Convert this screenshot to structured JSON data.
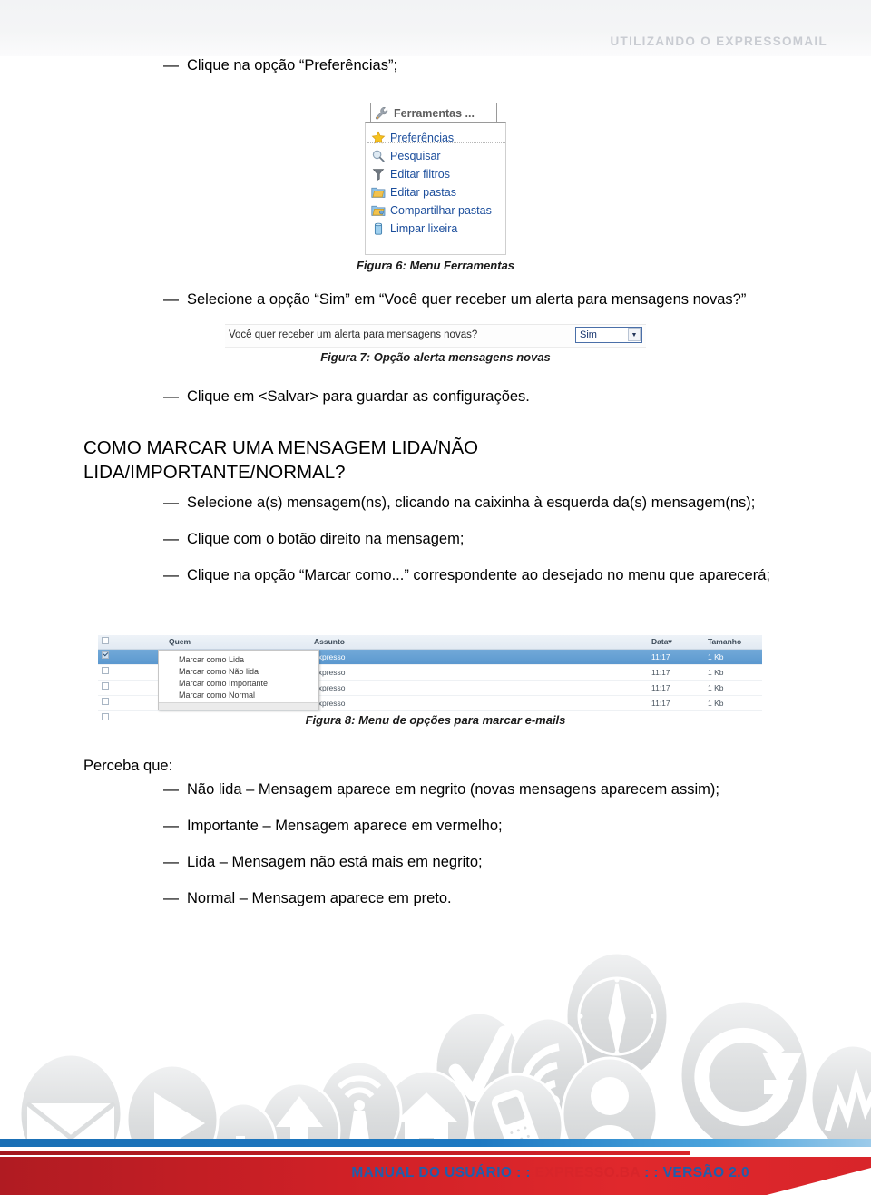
{
  "header": {
    "title": "UTILIZANDO O EXPRESSOMAIL"
  },
  "body": {
    "step_preferencias": "Clique na opção “Preferências”;",
    "step_sim": "Selecione a opção “Sim” em “Você quer receber um alerta para mensagens novas?”",
    "step_salvar": "Clique em <Salvar> para guardar as configurações.",
    "heading_marcar": "COMO MARCAR UMA MENSAGEM LIDA/NÃO LIDA/IMPORTANTE/NORMAL?",
    "step_selecione": "Selecione a(s) mensagem(ns), clicando na caixinha à esquerda da(s) mensagem(ns);",
    "step_botao_direito": "Clique com o botão direito na mensagem;",
    "step_marcar_como": "Clique na opção “Marcar como...” correspondente ao desejado no menu que aparecerá;",
    "perceba_que": "Perceba que:",
    "note_nao_lida": "Não lida – Mensagem aparece em negrito (novas mensagens aparecem assim);",
    "note_importante": "Importante – Mensagem aparece em vermelho;",
    "note_lida": "Lida – Mensagem não está mais em negrito;",
    "note_normal": "Normal – Mensagem aparece em preto.",
    "dash": "—"
  },
  "figure6": {
    "caption": "Figura 6: Menu Ferramentas",
    "tab_label": "Ferramentas ...",
    "tab_icon": "wrench-icon",
    "items": [
      {
        "label": "Preferências",
        "icon": "star-icon"
      },
      {
        "label": "Pesquisar",
        "icon": "magnifier-icon"
      },
      {
        "label": "Editar filtros",
        "icon": "funnel-icon"
      },
      {
        "label": "Editar pastas",
        "icon": "folder-icon"
      },
      {
        "label": "Compartilhar pastas",
        "icon": "shared-folder-icon"
      },
      {
        "label": "Limpar lixeira",
        "icon": "trash-icon"
      }
    ]
  },
  "figure7": {
    "caption": "Figura 7: Opção alerta mensagens novas",
    "question": "Você quer receber um alerta para mensagens novas?",
    "selected_value": "Sim",
    "arrow_icon": "chevron-down-icon"
  },
  "figure8": {
    "caption": "Figura 8: Menu de opções para marcar e-mails",
    "columns": [
      "Quem",
      "Assunto",
      "Data▾",
      "Tamanho"
    ],
    "rows": [
      {
        "quem": "",
        "assunto": "expresso",
        "data": "11:17",
        "tamanho": "1 Kb",
        "selected": true
      },
      {
        "quem": "",
        "assunto": "expresso",
        "data": "11:17",
        "tamanho": "1 Kb",
        "selected": false
      },
      {
        "quem": "",
        "assunto": "expresso",
        "data": "11:17",
        "tamanho": "1 Kb",
        "selected": false
      },
      {
        "quem": "",
        "assunto": "expresso",
        "data": "11:17",
        "tamanho": "1 Kb",
        "selected": false
      }
    ],
    "context_menu": [
      "Marcar como Lida",
      "Marcar como Não lida",
      "Marcar como Importante",
      "Marcar como Normal"
    ]
  },
  "footer": {
    "text_before": "MANUAL DO USUÁRIO : : ",
    "brand": "EXPRESSO.BA",
    "text_after": " : : VERSÃO 2.0",
    "accent_blue": "#1f5fae",
    "accent_red": "#d8252a"
  },
  "watermark": {
    "icons": [
      "envelope-icon",
      "play-icon",
      "bar-chart-icon",
      "upload-arrow-icon",
      "wifi-icon",
      "home-icon",
      "check-icon",
      "mobile-phone-icon",
      "user-icon",
      "refresh-icon",
      "compass-icon",
      "signal-icon"
    ]
  }
}
